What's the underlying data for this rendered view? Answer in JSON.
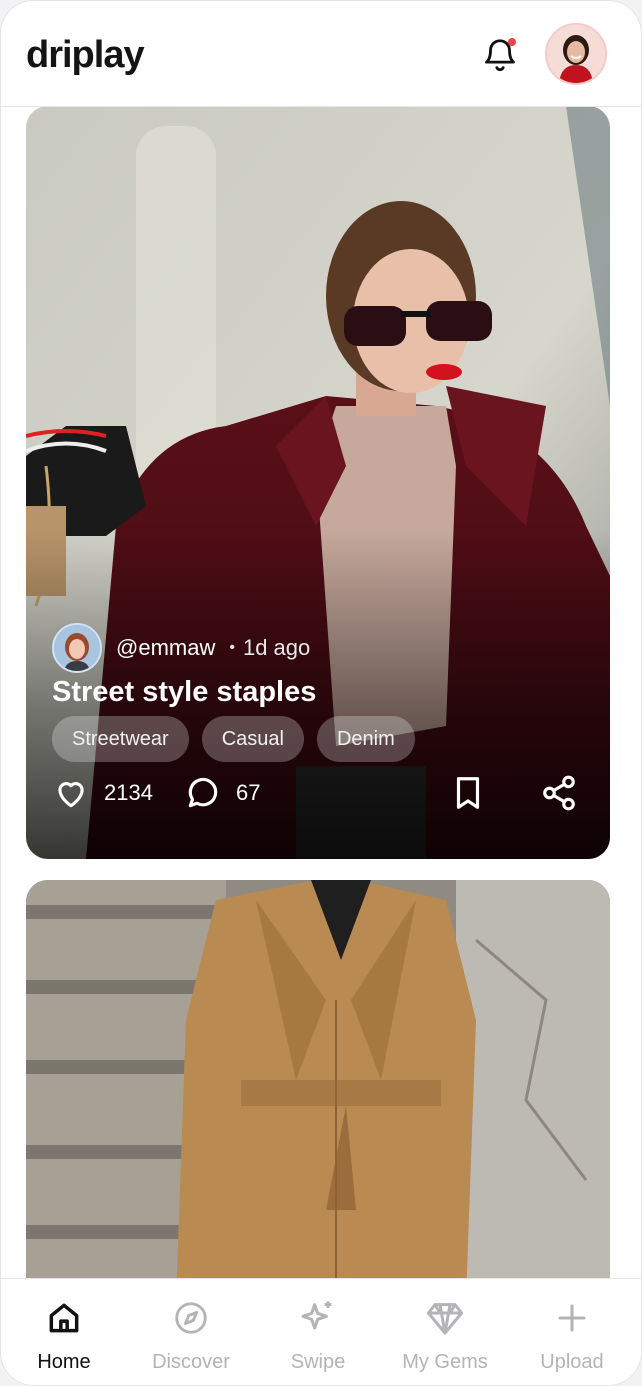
{
  "app": {
    "name": "driplay"
  },
  "header": {
    "notification_has_unread": true,
    "accent_dot_color": "#ef4444"
  },
  "feed": {
    "posts": [
      {
        "username": "@emmaw",
        "separator": "•",
        "time_ago": "1d ago",
        "title": "Street style staples",
        "tags": [
          "Streetwear",
          "Casual",
          "Denim"
        ],
        "likes": "2134",
        "comments": "67"
      }
    ]
  },
  "tabbar": {
    "items": [
      {
        "label": "Home",
        "icon": "home-icon",
        "active": true
      },
      {
        "label": "Discover",
        "icon": "compass-icon",
        "active": false
      },
      {
        "label": "Swipe",
        "icon": "sparkle-icon",
        "active": false
      },
      {
        "label": "My Gems",
        "icon": "gem-icon",
        "active": false
      },
      {
        "label": "Upload",
        "icon": "plus-icon",
        "active": false
      }
    ]
  }
}
